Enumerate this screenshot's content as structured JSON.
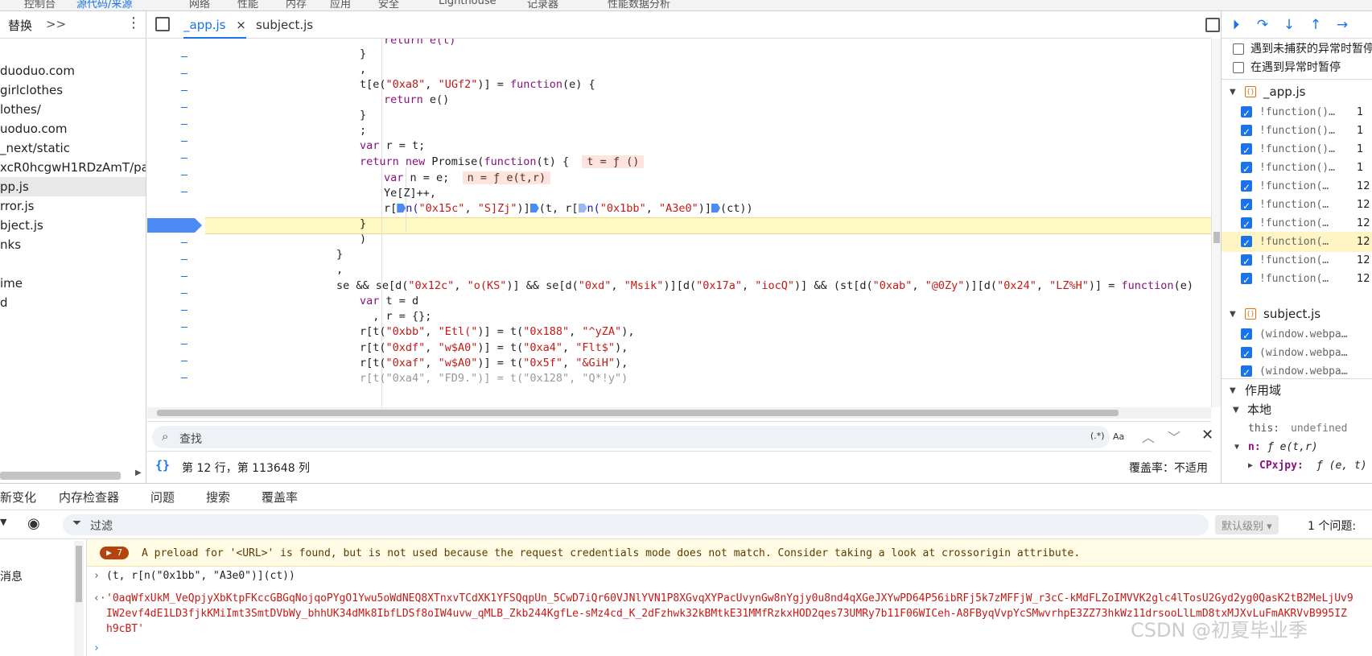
{
  "top_tabs": [
    "控制台",
    "源代码/来源",
    "网络",
    "性能",
    "内存",
    "应用",
    "安全",
    "Lighthouse",
    "记录器",
    "性能数据分析"
  ],
  "navigator": {
    "replace_label": "替换",
    "more_label": ">>",
    "items": [
      "duoduo.com",
      "girlclothes",
      "lothes/",
      "uoduo.com",
      "_next/static",
      "xcR0hcgwH1RDzAmT/pag",
      "pp.js",
      "rror.js",
      "bject.js",
      "nks",
      "",
      "ime",
      "d"
    ]
  },
  "editor": {
    "tabs": [
      {
        "label": "_app.js",
        "close": "×"
      },
      {
        "label": "subject.js"
      }
    ],
    "code_lines": [
      {
        "indent": 28,
        "html_key": "l0"
      },
      {
        "indent": 28,
        "html_key": "l1"
      }
    ],
    "lines": {
      "l0": "return e(t)",
      "l1": "}",
      "l2": ",",
      "l3a": "t[e(",
      "l3b": "\"0xa8\"",
      "l3c": ", ",
      "l3d": "\"UGf2\"",
      "l3e": ")] = ",
      "l3f": "function",
      "l3g": "(e) {",
      "l4a": "return",
      "l4b": " e()",
      "l5": "}",
      "l6": ";",
      "l7a": "var",
      "l7b": " r = t;",
      "l8a": "return new",
      "l8b": " Promise(",
      "l8c": "function",
      "l8d": "(t) {",
      "l8e": "t = ƒ ()",
      "l9a": "var",
      "l9b": " n = e;",
      "l9c": "n = ƒ e(t,r)",
      "l10": "Ye[Z]++,",
      "l11a": "r[",
      "l11b": "n(",
      "l11c": "\"0x15c\"",
      "l11d": ", ",
      "l11e": "\"S]Zj\"",
      "l11f": ")]",
      "l11g": "(t, r[",
      "l11h": "n(",
      "l11i": "\"0x1bb\"",
      "l11j": ", ",
      "l11k": "\"A3e0\"",
      "l11l": ")]",
      "l11m": "(ct))",
      "l12": "}",
      "l13": ")",
      "l14": "}",
      "l15": ",",
      "l16a": "se && se[d(",
      "l16b": "\"0x12c\"",
      "l16c": ", ",
      "l16d": "\"o(KS\"",
      "l16e": ")] && se[d(",
      "l16f": "\"0xd\"",
      "l16g": ", ",
      "l16h": "\"Msik\"",
      "l16i": ")][d(",
      "l16j": "\"0x17a\"",
      "l16k": ", ",
      "l16l": "\"iocQ\"",
      "l16m": ")] && (st[d(",
      "l16n": "\"0xab\"",
      "l16o": ", ",
      "l16p": "\"@0Zy\"",
      "l16q": ")][d(",
      "l16r": "\"0x24\"",
      "l16s": ", ",
      "l16t": "\"LZ%H\"",
      "l16u": ")] = ",
      "l16v": "function",
      "l16w": "(e)",
      "l17a": "var",
      "l17b": " t = d",
      "l18": "  , r = {};",
      "l19a": "r[t(",
      "l19b": "\"0xbb\"",
      "l19c": ", ",
      "l19d": "\"Etl(\"",
      "l19e": ")] = t(",
      "l19f": "\"0x188\"",
      "l19g": ", ",
      "l19h": "\"^yZA\"",
      "l19i": "),",
      "l20a": "r[t(",
      "l20b": "\"0xdf\"",
      "l20c": ", ",
      "l20d": "\"w$A0\"",
      "l20e": ")] = t(",
      "l20f": "\"0xa4\"",
      "l20g": ", ",
      "l20h": "\"Flt$\"",
      "l20i": "),",
      "l21a": "r[t(",
      "l21b": "\"0xaf\"",
      "l21c": ", ",
      "l21d": "\"w$A0\"",
      "l21e": ")] = t(",
      "l21f": "\"0x5f\"",
      "l21g": ", ",
      "l21h": "\"&GiH\"",
      "l21i": "),",
      "l22": "r[t(\"0xa4\", \"FD9.\")] = t(\"0x128\", \"Q*!y\")"
    }
  },
  "search": {
    "placeholder": "查找",
    "regex": "(.*)",
    "case": "Aa"
  },
  "status": {
    "position": "第 12 行，第 113648 列",
    "coverage": "覆盖率：不适用"
  },
  "debugger": {
    "pause_uncaught": "遇到未捕获的异常时暂停",
    "pause_caught": "在遇到异常时暂停",
    "files": [
      {
        "name": "_app.js",
        "breakpoints": [
          {
            "label": "!function()…",
            "line": "1"
          },
          {
            "label": "!function()…",
            "line": "1"
          },
          {
            "label": "!function()…",
            "line": "1"
          },
          {
            "label": "!function()…",
            "line": "1"
          },
          {
            "label": "!function(…",
            "line": "12"
          },
          {
            "label": "!function(…",
            "line": "12"
          },
          {
            "label": "!function(…",
            "line": "12"
          },
          {
            "label": "!function(…",
            "line": "12"
          },
          {
            "label": "!function(…",
            "line": "12"
          },
          {
            "label": "!function(…",
            "line": "12"
          }
        ]
      },
      {
        "name": "subject.js",
        "breakpoints": [
          {
            "label": "(window.webpa…"
          },
          {
            "label": "(window.webpa…"
          },
          {
            "label": "(window.webpa…"
          }
        ]
      }
    ],
    "scope_header": "作用域",
    "local_header": "本地",
    "scope_this_key": "this:",
    "scope_this_val": "undefined",
    "scope_n_key": "n:",
    "scope_n_val": "ƒ e(t,r)",
    "scope_c_key": "CPxjpy:",
    "scope_c_val": "ƒ (e, t)"
  },
  "drawer": {
    "tabs": [
      "新变化",
      "内存检查器",
      "问题",
      "搜索",
      "覆盖率"
    ],
    "filter_placeholder": "过滤",
    "level": "默认级别 ▾",
    "issues": "1 个问题:",
    "side_items": [
      "",
      "消息",
      "",
      ""
    ],
    "warn_count": "7",
    "warn_text": "A preload for '<URL>' is found, but is not used because the request credentials mode does not match. Consider taking a look at crossorigin attribute.",
    "input_line": "(t, r[n(\"0x1bb\", \"A3e0\")](ct))",
    "result_line1": "'0aqWfxUkM_VeQpjyXbKtpFKccGBGqNojqoPYgO1Ywu5oWdNEQ8XTnxvTCdXK1YFSQqpUn_5CwD7iQr60VJNlYVN1P8XGvqXYPacUvynGw8nYgjy0u8nd4qXGeJXYwPD64P56ibRFj5k7zMFFjW_r3cC-kMdFLZoIMVVK2glc4lTosU2Gyd2yg0QasK2tB2MeLjUv9",
    "result_line2": "IW2evf4dE1LD3fjkKMiImt3SmtDVbWy_bhhUK34dMk8IbfLDSf8oIW4uvw_qMLB_Zkb244KgfLe-sMz4cd_K_2dFzhwk32kBMtkE31MMfRzkxHOD2qes73UMRy7b11F06WICeh-A8FByqVvpYcSMwvrhpE3ZZ73hkWz11drsooLlLmD8txMJXvLuFmAKRVvB995IZ",
    "result_line3": "h9cBT'",
    "watermark": "CSDN @初夏毕业季"
  }
}
